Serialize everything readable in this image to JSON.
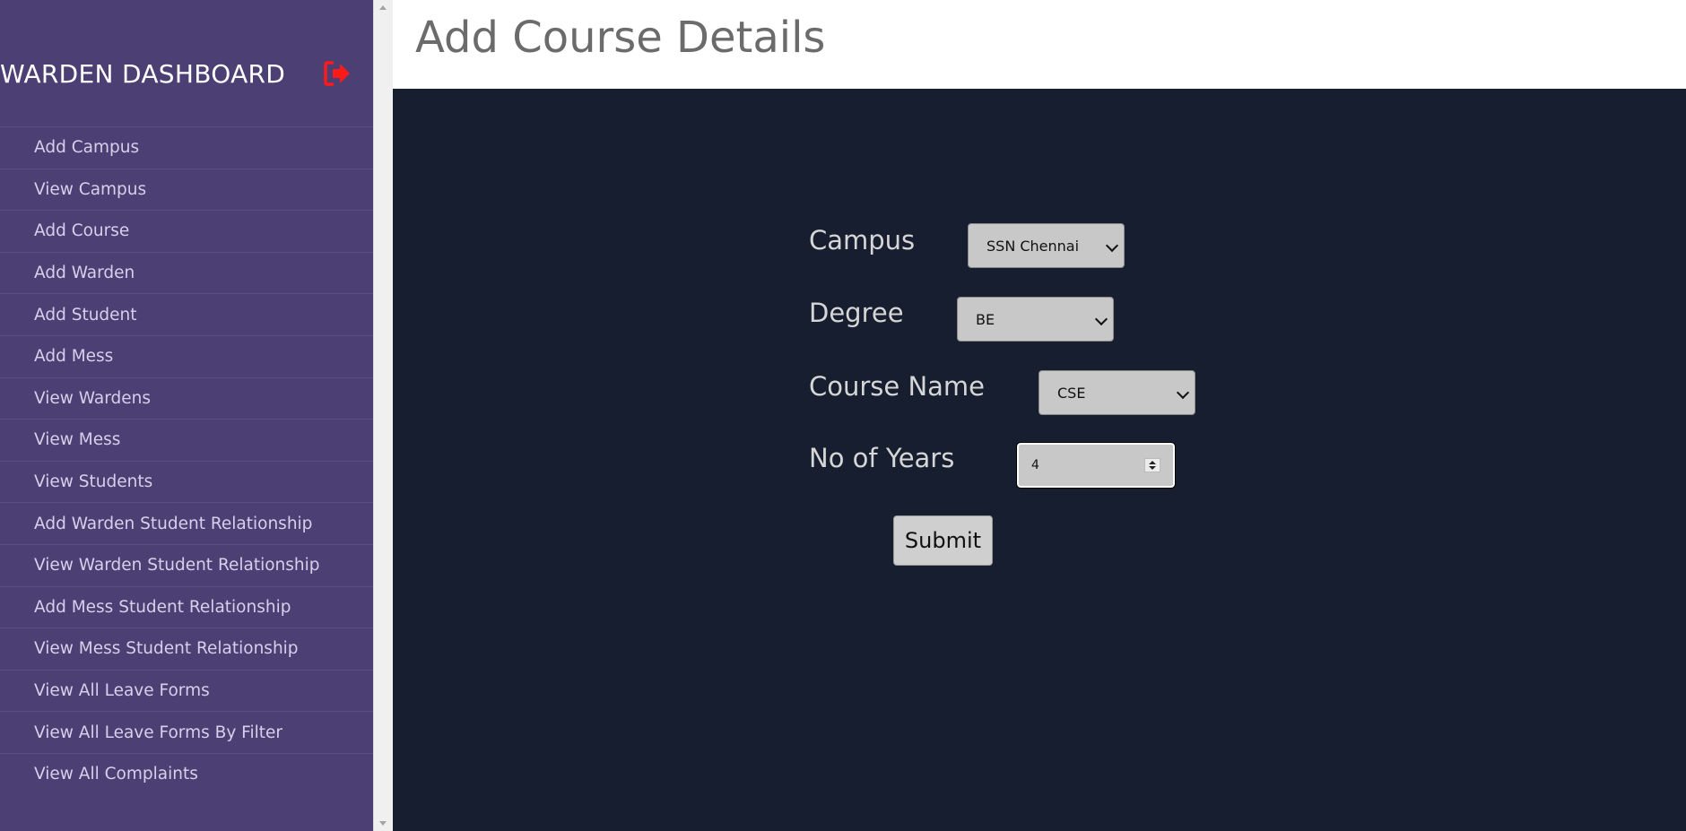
{
  "sidebar": {
    "title": "WARDEN DASHBOARD",
    "logout_icon": "sign-out-icon",
    "logout_color": "#ff1a1a",
    "items": [
      {
        "label": "Add Campus"
      },
      {
        "label": "View Campus"
      },
      {
        "label": "Add Course"
      },
      {
        "label": "Add Warden"
      },
      {
        "label": "Add Student"
      },
      {
        "label": "Add Mess"
      },
      {
        "label": "View Wardens"
      },
      {
        "label": "View Mess"
      },
      {
        "label": "View Students"
      },
      {
        "label": "Add Warden Student Relationship"
      },
      {
        "label": "View Warden Student Relationship"
      },
      {
        "label": "Add Mess Student Relationship"
      },
      {
        "label": "View Mess Student Relationship"
      },
      {
        "label": "View All Leave Forms"
      },
      {
        "label": "View All Leave Forms By Filter"
      },
      {
        "label": "View All Complaints"
      }
    ]
  },
  "header": {
    "title": "Add Course Details"
  },
  "form": {
    "campus": {
      "label": "Campus",
      "value": "SSN Chennai"
    },
    "degree": {
      "label": "Degree",
      "value": "BE"
    },
    "course_name": {
      "label": "Course Name",
      "value": "CSE"
    },
    "years": {
      "label": "No of Years",
      "value": "4"
    },
    "submit_label": "Submit"
  },
  "colors": {
    "sidebar_bg": "#4b3f74",
    "main_bg": "#161e30",
    "header_bg": "#ffffff"
  }
}
